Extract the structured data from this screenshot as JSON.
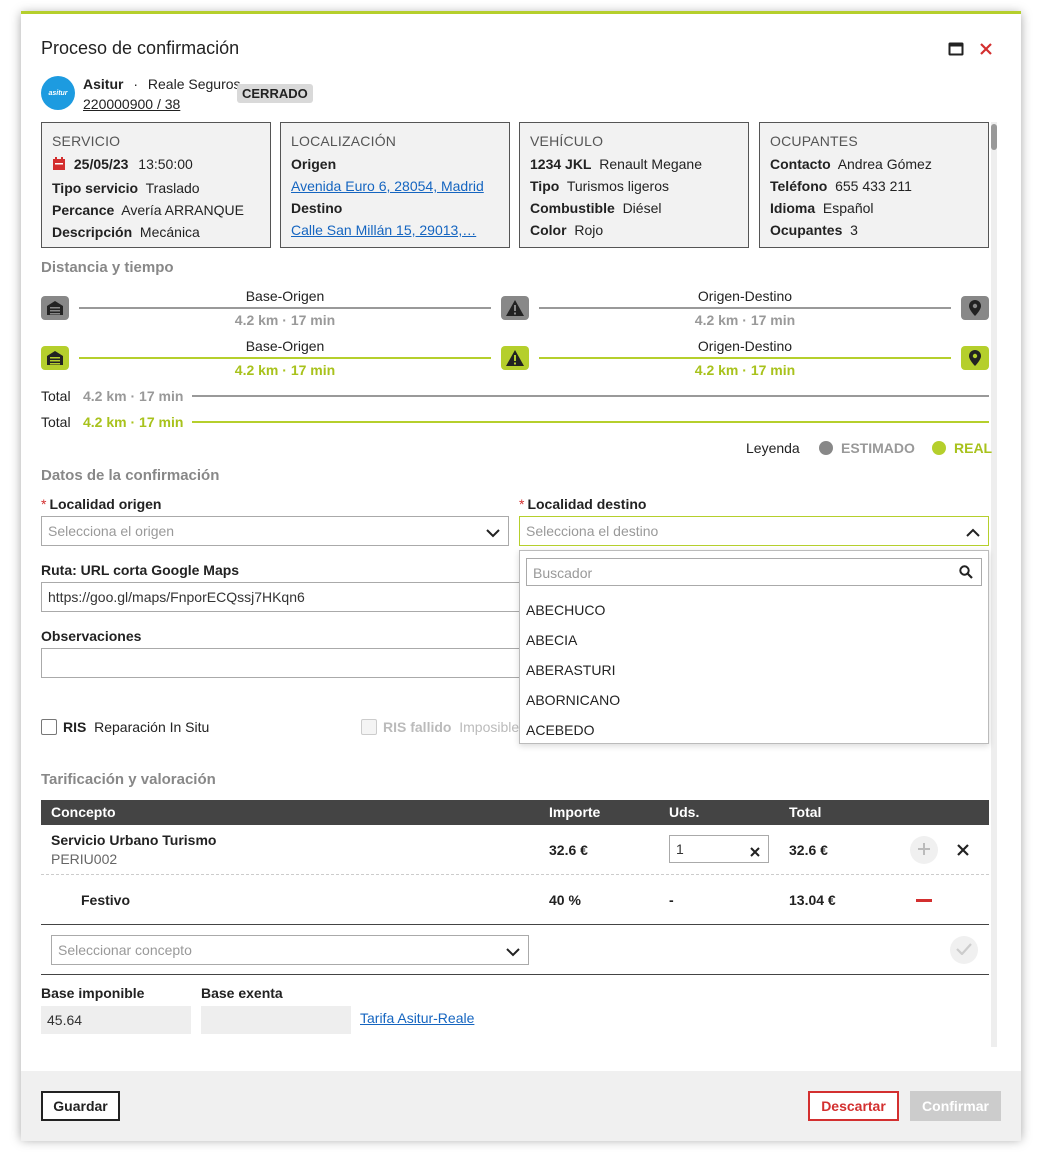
{
  "modal": {
    "title": "Proceso de confirmación",
    "company_name": "Asitur",
    "insurer": "Reale Seguros",
    "claim_number": "220000900 / 38",
    "status_badge": "CERRADO",
    "logo_text": "asitur"
  },
  "cards": {
    "servicio": {
      "title": "SERVICIO",
      "date": "25/05/23",
      "time": "13:50:00",
      "rows": [
        {
          "k": "Tipo servicio",
          "v": "Traslado"
        },
        {
          "k": "Percance",
          "v": "Avería ARRANQUE"
        },
        {
          "k": "Descripción",
          "v": "Mecánica"
        }
      ]
    },
    "localizacion": {
      "title": "LOCALIZACIÓN",
      "origin_label": "Origen",
      "origin_value": "Avenida Euro 6, 28054, Madrid",
      "dest_label": "Destino",
      "dest_value": "Calle San Millán 15, 29013,…"
    },
    "vehiculo": {
      "title": "VEHÍCULO",
      "plate": "1234 JKL",
      "model": "Renault Megane",
      "rows": [
        {
          "k": "Tipo",
          "v": "Turismos ligeros"
        },
        {
          "k": "Combustible",
          "v": "Diésel"
        },
        {
          "k": "Color",
          "v": "Rojo"
        }
      ]
    },
    "ocupantes": {
      "title": "OCUPANTES",
      "rows": [
        {
          "k": "Contacto",
          "v": "Andrea Gómez"
        },
        {
          "k": "Teléfono",
          "v": "655 433 211"
        },
        {
          "k": "Idioma",
          "v": "Español"
        },
        {
          "k": "Ocupantes",
          "v": "3"
        }
      ]
    }
  },
  "distance": {
    "section_title": "Distancia y tiempo",
    "estimated": {
      "seg1_label": "Base-Origen",
      "seg1_value": "4.2 km · 17 min",
      "seg2_label": "Origen-Destino",
      "seg2_value": "4.2 km · 17 min"
    },
    "real": {
      "seg1_label": "Base-Origen",
      "seg1_value": "4.2 km · 17 min",
      "seg2_label": "Origen-Destino",
      "seg2_value": "4.2 km · 17 min"
    },
    "total_label": "Total",
    "total_estimated": "4.2 km · 17 min",
    "total_real": "4.2 km · 17 min",
    "legend_label": "Leyenda",
    "legend_estimated": "ESTIMADO",
    "legend_real": "REAL",
    "colors": {
      "estimated": "#888888",
      "real": "#b5cf2c"
    }
  },
  "confirmation": {
    "section_title": "Datos de la confirmación",
    "origin_label": "Localidad origen",
    "origin_placeholder": "Selecciona el origen",
    "dest_label": "Localidad destino",
    "dest_placeholder": "Selecciona el destino",
    "route_label": "Ruta: URL corta Google Maps",
    "route_value": "https://goo.gl/maps/FnporECQssj7HKqn6",
    "observations_label": "Observaciones",
    "observations_value": "",
    "ris_label": "RIS",
    "ris_desc": "Reparación In Situ",
    "ris_failed_label": "RIS fallido",
    "ris_failed_desc": "Imposible",
    "dropdown": {
      "search_placeholder": "Buscador",
      "items": [
        "ABECHUCO",
        "ABECIA",
        "ABERASTURI",
        "ABORNICANO",
        "ACEBEDO"
      ]
    }
  },
  "pricing": {
    "section_title": "Tarificación y valoración",
    "headers": {
      "concept": "Concepto",
      "amount": "Importe",
      "units": "Uds.",
      "total": "Total"
    },
    "row1": {
      "concept": "Servicio Urbano Turismo",
      "code": "PERIU002",
      "amount": "32.6 €",
      "units": "1",
      "total": "32.6 €"
    },
    "row2": {
      "concept": "Festivo",
      "amount": "40 %",
      "units": "-",
      "total": "13.04 €"
    },
    "select_placeholder": "Seleccionar concepto",
    "base_label": "Base imponible",
    "base_value": "45.64",
    "exempt_label": "Base exenta",
    "exempt_value": "",
    "tariff_link": "Tarifa Asitur-Reale"
  },
  "footer": {
    "save": "Guardar",
    "discard": "Descartar",
    "confirm": "Confirmar"
  }
}
